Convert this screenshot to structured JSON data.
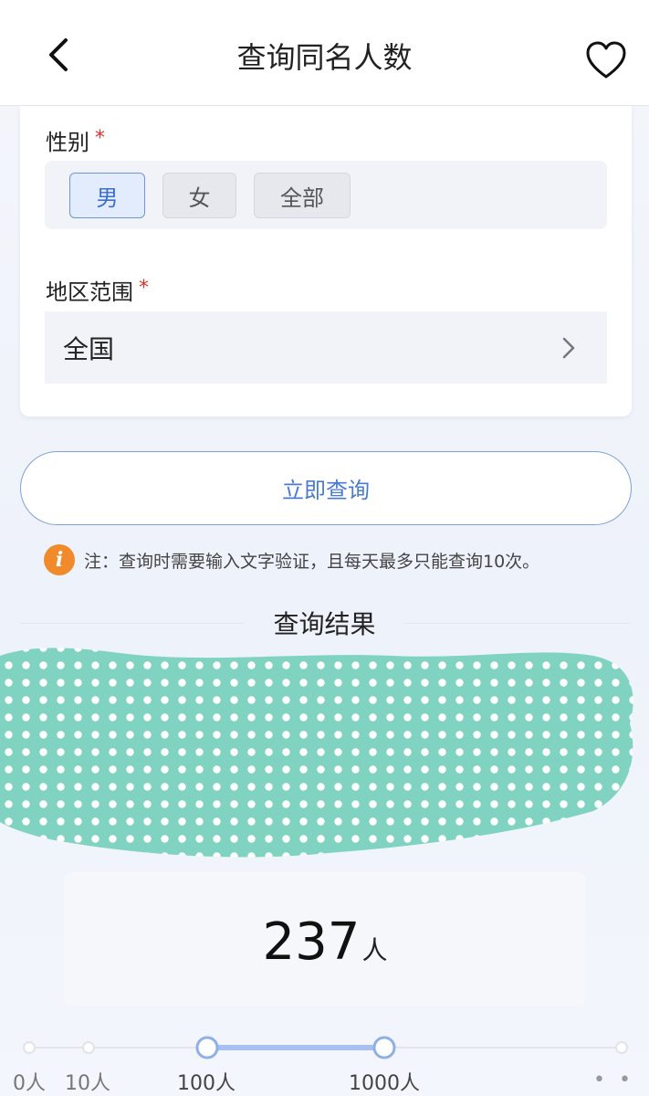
{
  "header": {
    "title": "查询同名人数"
  },
  "form": {
    "gender": {
      "label": "性别",
      "required_mark": "*",
      "options": [
        "男",
        "女",
        "全部"
      ],
      "selected": "男"
    },
    "region": {
      "label": "地区范围",
      "required_mark": "*",
      "value": "全国"
    }
  },
  "query_button": "立即查询",
  "note": {
    "icon": "i",
    "text": "注：查询时需要输入文字验证，且每天最多只能查询10次。"
  },
  "result": {
    "title": "查询结果",
    "count": "237",
    "unit": "人"
  },
  "scale": {
    "labels": [
      "0人",
      "10人",
      "100人",
      "1000人"
    ],
    "active_range": [
      "100人",
      "1000人"
    ],
    "more": "• • •"
  },
  "colors": {
    "accent": "#4a7bd0",
    "required": "#e0312a",
    "info": "#f08a2a",
    "redaction": "#7fd3c0"
  }
}
